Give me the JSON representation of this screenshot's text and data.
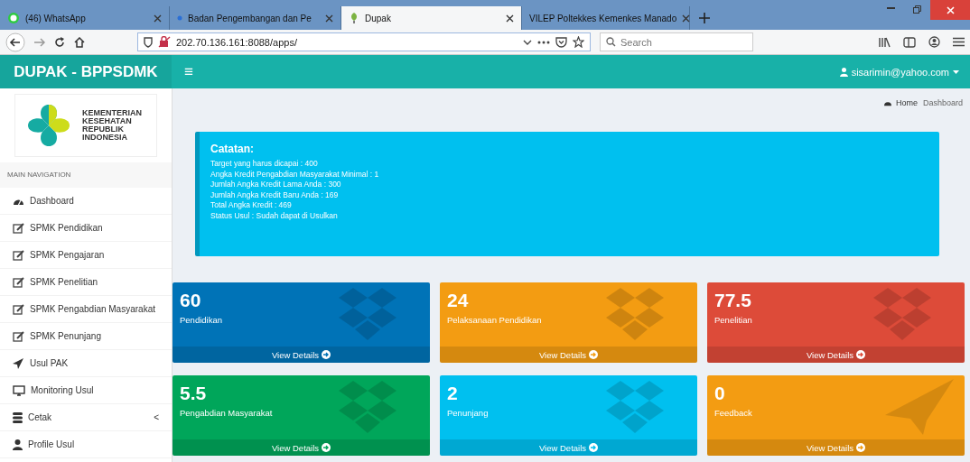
{
  "browser": {
    "tabs": [
      {
        "label": "(46) WhatsApp",
        "selected": false,
        "kind": "whatsapp"
      },
      {
        "label": "Badan Pengembangan dan Pe",
        "selected": false,
        "kind": "dot"
      },
      {
        "label": "Dupak",
        "selected": true,
        "kind": "leaf"
      },
      {
        "label": "VILEP Poltekkes Kemenkes Manado",
        "selected": false,
        "kind": "none"
      }
    ],
    "address": "202.70.136.161:8088/apps/",
    "search": {
      "placeholder": "Search"
    }
  },
  "header": {
    "brand": "DUPAK - BPPSDMK",
    "menu_glyph": "≡",
    "user": "sisarimin@yahoo.com"
  },
  "sidebar": {
    "logo_text": [
      "KEMENTERIAN",
      "KESEHATAN",
      "REPUBLIK",
      "INDONESIA"
    ],
    "section": "MAIN NAVIGATION",
    "items": [
      {
        "label": "Dashboard",
        "kind": "dashboard"
      },
      {
        "label": "SPMK Pendidikan",
        "kind": "edit"
      },
      {
        "label": "SPMK Pengajaran",
        "kind": "edit"
      },
      {
        "label": "SPMK Penelitian",
        "kind": "edit"
      },
      {
        "label": "SPMK Pengabdian Masyarakat",
        "kind": "edit"
      },
      {
        "label": "SPMK Penunjang",
        "kind": "edit"
      },
      {
        "label": "Usul PAK",
        "kind": "send"
      },
      {
        "label": "Monitoring Usul",
        "kind": "monitor"
      },
      {
        "label": "Cetak",
        "kind": "database",
        "chevron": "<"
      },
      {
        "label": "Profile Usul",
        "kind": "user"
      }
    ]
  },
  "breadcrumb": [
    "Home",
    "Dashboard"
  ],
  "callout": {
    "title": "Catatan:",
    "lines": [
      "Target yang harus dicapai : 400",
      "Angka Kredit Pengabdian Masyarakat Minimal : 1",
      "Jumlah Angka Kredit Lama Anda : 300",
      "Jumlah Angka Kredit Baru Anda : 169",
      "Total Angka Kredit : 469",
      "Status Usul : Sudah dapat di Usulkan"
    ]
  },
  "boxes": [
    {
      "value": "60",
      "label": "Pendidikan",
      "link": "View Details",
      "color": "#0073b7",
      "kind": "dropbox"
    },
    {
      "value": "24",
      "label": "Pelaksanaan Pendidikan",
      "link": "View Details",
      "color": "#f39c12",
      "kind": "dropbox"
    },
    {
      "value": "77.5",
      "label": "Penelitian",
      "link": "View Details",
      "color": "#dd4b39",
      "kind": "dropbox"
    },
    {
      "value": "5.5",
      "label": "Pengabdian Masyarakat",
      "link": "View Details",
      "color": "#00a65a",
      "kind": "dropbox"
    },
    {
      "value": "2",
      "label": "Penunjang",
      "link": "View Details",
      "color": "#00c0ef",
      "kind": "dropbox"
    },
    {
      "value": "0",
      "label": "Feedback",
      "link": "View Details",
      "color": "#f39c12",
      "kind": "plane"
    }
  ]
}
